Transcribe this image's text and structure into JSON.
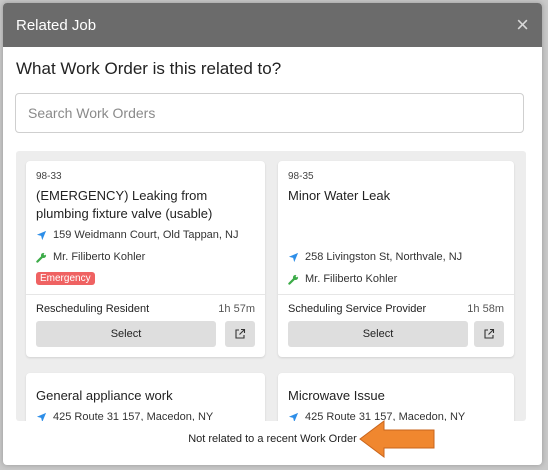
{
  "modal": {
    "title": "Related Job",
    "close_glyph": "×",
    "question": "What Work Order is this related to?"
  },
  "search": {
    "placeholder": "Search Work Orders",
    "value": ""
  },
  "work_orders": [
    {
      "id": "98-33",
      "title": "(EMERGENCY) Leaking from plumbing fixture valve (usable)",
      "address": "159 Weidmann Court, Old Tappan, NJ",
      "technician": "Mr. Filiberto Kohler",
      "badge": "Emergency",
      "status": "Rescheduling Resident",
      "time": "1h 57m",
      "select_label": "Select"
    },
    {
      "id": "98-35",
      "title": "Minor Water Leak",
      "address": "258 Livingston St, Northvale, NJ",
      "technician": "Mr. Filiberto Kohler",
      "status": "Scheduling Service Provider",
      "time": "1h 58m",
      "select_label": "Select"
    },
    {
      "title": "General appliance work",
      "address": "425 Route 31 157, Macedon, NY"
    },
    {
      "title": "Microwave Issue",
      "address": "425 Route 31 157, Macedon, NY"
    }
  ],
  "footer": {
    "not_related_label": "Not related to a recent Work Order"
  },
  "icons": {
    "location": "location-arrow-icon",
    "technician": "wrench-icon",
    "external": "external-link-icon",
    "close": "close-icon",
    "annotation": "orange-arrow-pointer"
  },
  "colors": {
    "header_bg": "#6b6b6b",
    "location_icon": "#2d8ee8",
    "technician_icon": "#3cab48",
    "emergency_badge": "#ef6262",
    "annotation_arrow": "#f0872f"
  }
}
